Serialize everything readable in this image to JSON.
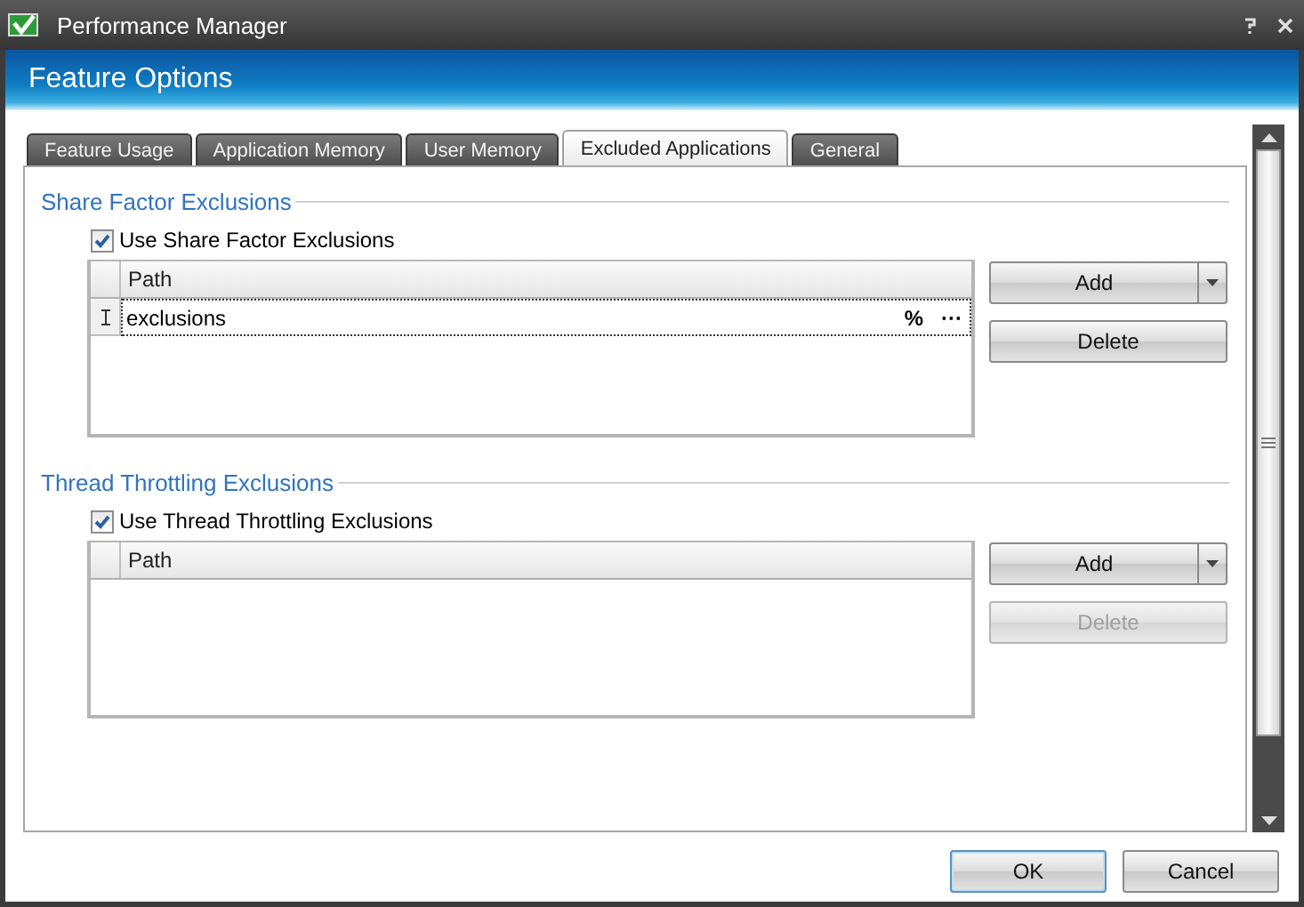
{
  "window": {
    "title": "Performance Manager"
  },
  "header": {
    "title": "Feature Options"
  },
  "tabs": [
    {
      "label": "Feature Usage",
      "selected": false
    },
    {
      "label": "Application Memory",
      "selected": false
    },
    {
      "label": "User Memory",
      "selected": false
    },
    {
      "label": "Excluded Applications",
      "selected": true
    },
    {
      "label": "General",
      "selected": false
    }
  ],
  "sections": [
    {
      "title": "Share Factor Exclusions",
      "checkbox": {
        "label": "Use Share Factor Exclusions",
        "checked": true
      },
      "grid": {
        "columns": [
          "Path"
        ],
        "rows": [
          {
            "cells": [
              "exclusions"
            ],
            "selected": true,
            "editing": true,
            "markers": [
              "%",
              "···"
            ]
          }
        ]
      },
      "buttons": [
        {
          "label": "Add",
          "kind": "split",
          "disabled": false
        },
        {
          "label": "Delete",
          "kind": "plain",
          "disabled": false
        }
      ]
    },
    {
      "title": "Thread Throttling Exclusions",
      "checkbox": {
        "label": "Use Thread Throttling Exclusions",
        "checked": true
      },
      "grid": {
        "columns": [
          "Path"
        ]
      },
      "buttons": [
        {
          "label": "Add",
          "kind": "split",
          "disabled": false
        },
        {
          "label": "Delete",
          "kind": "plain",
          "disabled": true
        }
      ]
    }
  ],
  "footer": {
    "buttons": [
      {
        "label": "OK",
        "default": true
      },
      {
        "label": "Cancel",
        "default": false
      }
    ]
  }
}
